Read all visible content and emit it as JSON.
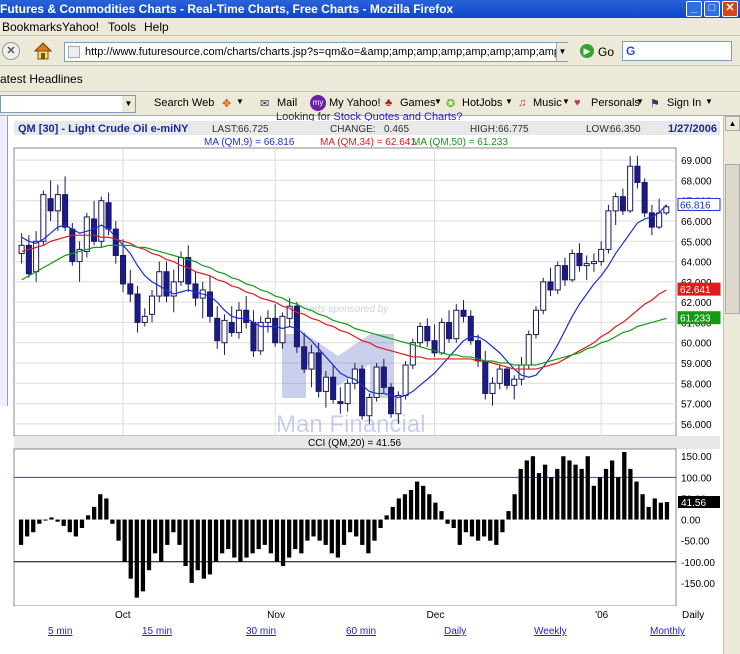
{
  "window": {
    "title": "Futures & Commodities Charts - Real-Time Charts, Free Charts - Mozilla Firefox"
  },
  "menu": [
    "Bookmarks",
    "Yahoo!",
    "Tools",
    "Help"
  ],
  "nav": {
    "url": "http://www.futuresource.com/charts/charts.jsp?s=qm&o=&amp;amp;amp;amp;amp;amp;amp;amp;amp;a=D",
    "go_label": "Go"
  },
  "bookmarks": {
    "headlines": "atest Headlines"
  },
  "ytoolbar": {
    "search_web": "Search Web",
    "mail": "Mail",
    "my_yahoo": "My Yahoo!",
    "games": "Games",
    "hotjobs": "HotJobs",
    "music": "Music",
    "personals": "Personals",
    "sign_in": "Sign In"
  },
  "page": {
    "top_link_prefix": "Looking for",
    "top_link": "Stock Quotes and Charts?"
  },
  "chart_header": {
    "symbol": "QM [30] - Light Crude Oil e-miNY",
    "last_label": "LAST:",
    "last": "66.725",
    "change_label": "CHANGE:",
    "change": "0.465",
    "high_label": "HIGH:",
    "high": "66.775",
    "low_label": "LOW:",
    "low": "66.350",
    "date": "1/27/2006",
    "ma9": "MA (QM,9) = 66.816",
    "ma34": "MA (QM,34) = 62.641",
    "ma50": "MA (QM,50) = 61.233"
  },
  "watermark": {
    "sponsor": "Charts sponsored by",
    "brand": "Man Financial"
  },
  "cci_label": "CCI (QM,20) = 41.56",
  "colors": {
    "ma9": "#1c2fd6",
    "ma34": "#e21a1a",
    "ma50": "#159a15",
    "candle_up": "#ffffff",
    "candle_down": "#1a1a8a",
    "cci_bar": "#000000",
    "cci_ref": "#3b3bcc"
  },
  "bottom_tabs": [
    "5 min",
    "15 min",
    "30 min",
    "60 min",
    "Daily",
    "Weekly",
    "Monthly"
  ],
  "chart_data": [
    {
      "type": "candlestick",
      "title": "QM [30] - Light Crude Oil e-miNY",
      "x_labels": [
        "Oct",
        "Nov",
        "Dec",
        "'06",
        "Daily"
      ],
      "ylim": [
        55.5,
        69.5
      ],
      "y_ticks": [
        56,
        57,
        58,
        59,
        60,
        61,
        62,
        63,
        64,
        65,
        66,
        67,
        68,
        69
      ],
      "price_tags": [
        {
          "value": 66.816,
          "series": "MA9"
        },
        {
          "value": 62.641,
          "series": "MA34"
        },
        {
          "value": 61.233,
          "series": "MA50"
        }
      ],
      "ohlc": [
        [
          64.4,
          65.4,
          63.9,
          64.8
        ],
        [
          64.8,
          65.3,
          63.2,
          63.4
        ],
        [
          63.5,
          65.5,
          63.0,
          65.0
        ],
        [
          65.0,
          67.5,
          64.8,
          67.3
        ],
        [
          67.1,
          68.0,
          66.0,
          66.5
        ],
        [
          66.5,
          67.8,
          65.5,
          67.3
        ],
        [
          67.3,
          68.2,
          65.5,
          65.7
        ],
        [
          65.6,
          65.9,
          63.8,
          64.0
        ],
        [
          64.0,
          65.0,
          63.0,
          64.6
        ],
        [
          64.5,
          66.4,
          64.2,
          66.2
        ],
        [
          66.1,
          67.0,
          64.8,
          65.0
        ],
        [
          65.0,
          67.2,
          64.7,
          67.0
        ],
        [
          66.9,
          67.4,
          65.3,
          65.6
        ],
        [
          65.6,
          66.0,
          63.9,
          64.3
        ],
        [
          64.3,
          65.1,
          62.5,
          62.9
        ],
        [
          62.9,
          63.6,
          62.0,
          62.4
        ],
        [
          62.4,
          62.8,
          60.5,
          61.0
        ],
        [
          61.0,
          61.7,
          60.8,
          61.3
        ],
        [
          61.4,
          62.6,
          61.0,
          62.3
        ],
        [
          62.3,
          64.0,
          62.0,
          63.5
        ],
        [
          63.5,
          64.0,
          62.0,
          62.3
        ],
        [
          62.3,
          63.6,
          61.5,
          63.0
        ],
        [
          63.0,
          64.5,
          62.8,
          64.2
        ],
        [
          64.2,
          64.8,
          62.5,
          62.9
        ],
        [
          62.9,
          63.5,
          61.8,
          62.2
        ],
        [
          62.2,
          63.0,
          61.2,
          62.6
        ],
        [
          62.5,
          63.3,
          61.0,
          61.3
        ],
        [
          61.2,
          61.8,
          59.7,
          60.1
        ],
        [
          60.0,
          61.4,
          59.4,
          61.1
        ],
        [
          61.0,
          61.8,
          60.3,
          60.5
        ],
        [
          60.5,
          62.0,
          60.2,
          61.6
        ],
        [
          61.6,
          62.3,
          60.7,
          61.0
        ],
        [
          61.0,
          61.6,
          59.3,
          59.6
        ],
        [
          59.6,
          61.3,
          59.4,
          61.0
        ],
        [
          61.0,
          61.6,
          60.5,
          61.2
        ],
        [
          61.2,
          61.9,
          59.8,
          60.0
        ],
        [
          60.0,
          61.5,
          59.7,
          61.3
        ],
        [
          61.2,
          62.2,
          60.8,
          61.8
        ],
        [
          61.8,
          62.0,
          59.5,
          59.8
        ],
        [
          59.8,
          60.5,
          58.5,
          58.7
        ],
        [
          58.7,
          59.9,
          57.8,
          59.5
        ],
        [
          59.5,
          60.0,
          57.3,
          57.6
        ],
        [
          57.6,
          58.6,
          56.8,
          58.3
        ],
        [
          58.3,
          58.9,
          57.0,
          57.2
        ],
        [
          57.1,
          57.8,
          56.5,
          57.0
        ],
        [
          57.0,
          58.2,
          56.6,
          58.0
        ],
        [
          58.0,
          59.0,
          57.7,
          58.7
        ],
        [
          58.7,
          58.9,
          56.2,
          56.4
        ],
        [
          56.4,
          57.5,
          56.0,
          57.3
        ],
        [
          57.3,
          59.0,
          57.1,
          58.8
        ],
        [
          58.8,
          59.2,
          57.5,
          57.8
        ],
        [
          57.8,
          58.0,
          56.3,
          56.5
        ],
        [
          56.5,
          57.6,
          56.0,
          57.4
        ],
        [
          57.4,
          59.1,
          57.2,
          58.9
        ],
        [
          58.9,
          60.2,
          58.7,
          60.0
        ],
        [
          60.0,
          61.0,
          59.8,
          60.8
        ],
        [
          60.8,
          61.2,
          59.8,
          60.1
        ],
        [
          60.1,
          60.9,
          59.3,
          59.5
        ],
        [
          59.5,
          61.2,
          59.4,
          61.0
        ],
        [
          61.0,
          61.6,
          60.0,
          60.2
        ],
        [
          60.2,
          61.9,
          60.0,
          61.6
        ],
        [
          61.6,
          62.1,
          61.0,
          61.3
        ],
        [
          61.3,
          61.6,
          59.9,
          60.1
        ],
        [
          60.1,
          60.4,
          58.8,
          59.1
        ],
        [
          59.1,
          59.6,
          57.2,
          57.5
        ],
        [
          57.5,
          58.3,
          56.9,
          58.0
        ],
        [
          58.0,
          58.9,
          57.7,
          58.7
        ],
        [
          58.7,
          58.8,
          57.7,
          57.9
        ],
        [
          57.9,
          58.4,
          57.2,
          58.2
        ],
        [
          58.2,
          59.3,
          57.9,
          58.9
        ],
        [
          58.9,
          60.6,
          58.7,
          60.4
        ],
        [
          60.4,
          61.8,
          60.2,
          61.6
        ],
        [
          61.6,
          63.2,
          61.4,
          63.0
        ],
        [
          63.0,
          63.7,
          62.3,
          62.6
        ],
        [
          62.6,
          64.0,
          62.4,
          63.8
        ],
        [
          63.8,
          64.2,
          62.8,
          63.1
        ],
        [
          63.1,
          64.6,
          63.0,
          64.4
        ],
        [
          64.4,
          64.9,
          63.5,
          63.8
        ],
        [
          63.8,
          64.3,
          63.1,
          63.9
        ],
        [
          63.9,
          64.4,
          63.5,
          64.0
        ],
        [
          64.0,
          65.0,
          63.8,
          64.6
        ],
        [
          64.6,
          66.8,
          64.4,
          66.5
        ],
        [
          66.5,
          67.4,
          65.8,
          67.2
        ],
        [
          67.2,
          67.6,
          66.3,
          66.5
        ],
        [
          66.5,
          69.2,
          66.4,
          68.7
        ],
        [
          68.7,
          69.2,
          67.6,
          67.9
        ],
        [
          67.9,
          68.1,
          66.2,
          66.4
        ],
        [
          66.4,
          66.8,
          65.3,
          65.7
        ],
        [
          65.7,
          67.1,
          65.6,
          66.4
        ],
        [
          66.4,
          66.8,
          66.3,
          66.7
        ]
      ],
      "series": [
        {
          "name": "MA (QM,9)",
          "values": [
            65.2,
            65.0,
            64.9,
            65.1,
            65.4,
            65.7,
            65.8,
            65.6,
            65.4,
            65.5,
            65.6,
            65.8,
            65.6,
            65.2,
            64.8,
            64.4,
            63.8,
            63.3,
            63.0,
            62.8,
            62.6,
            62.4,
            62.5,
            62.6,
            62.5,
            62.4,
            62.3,
            62.0,
            61.6,
            61.3,
            61.2,
            61.2,
            61.0,
            60.8,
            60.8,
            60.8,
            60.7,
            60.8,
            60.7,
            60.4,
            60.1,
            59.7,
            59.3,
            58.9,
            58.5,
            58.3,
            58.2,
            57.9,
            57.6,
            57.5,
            57.5,
            57.4,
            57.3,
            57.4,
            57.6,
            57.9,
            58.2,
            58.5,
            58.9,
            59.3,
            59.7,
            60.1,
            60.3,
            60.3,
            60.1,
            59.8,
            59.5,
            59.1,
            58.7,
            58.4,
            58.3,
            58.4,
            58.8,
            59.3,
            59.9,
            60.6,
            61.3,
            61.9,
            62.4,
            62.9,
            63.3,
            63.8,
            64.4,
            64.9,
            65.4,
            65.9,
            66.1,
            66.2,
            66.4,
            66.8
          ]
        },
        {
          "name": "MA (QM,34)",
          "values": [
            64.5,
            64.6,
            64.7,
            64.8,
            65.0,
            65.1,
            65.2,
            65.3,
            65.3,
            65.3,
            65.3,
            65.2,
            65.2,
            65.1,
            65.0,
            64.9,
            64.7,
            64.6,
            64.4,
            64.3,
            64.1,
            64.0,
            63.8,
            63.7,
            63.5,
            63.4,
            63.3,
            63.1,
            63.0,
            62.8,
            62.7,
            62.5,
            62.4,
            62.2,
            62.1,
            62.0,
            61.8,
            61.7,
            61.5,
            61.4,
            61.2,
            61.1,
            60.9,
            60.8,
            60.6,
            60.5,
            60.3,
            60.1,
            60.0,
            59.8,
            59.7,
            59.6,
            59.5,
            59.4,
            59.3,
            59.3,
            59.2,
            59.2,
            59.2,
            59.2,
            59.2,
            59.2,
            59.2,
            59.1,
            59.1,
            59.0,
            58.9,
            58.8,
            58.7,
            58.7,
            58.7,
            58.7,
            58.8,
            58.9,
            59.0,
            59.2,
            59.4,
            59.6,
            59.8,
            60.0,
            60.3,
            60.5,
            60.8,
            61.0,
            61.3,
            61.6,
            61.9,
            62.1,
            62.4,
            62.6
          ]
        },
        {
          "name": "MA (QM,50)",
          "values": [
            63.1,
            63.3,
            63.5,
            63.7,
            63.9,
            64.1,
            64.3,
            64.4,
            64.5,
            64.6,
            64.7,
            64.7,
            64.8,
            64.8,
            64.8,
            64.8,
            64.7,
            64.7,
            64.6,
            64.5,
            64.4,
            64.3,
            64.2,
            64.1,
            64.0,
            63.8,
            63.7,
            63.5,
            63.4,
            63.2,
            63.1,
            62.9,
            62.8,
            62.6,
            62.5,
            62.3,
            62.2,
            62.0,
            61.9,
            61.7,
            61.6,
            61.4,
            61.3,
            61.1,
            61.0,
            60.9,
            60.7,
            60.6,
            60.5,
            60.4,
            60.3,
            60.2,
            60.1,
            60.0,
            59.9,
            59.8,
            59.7,
            59.6,
            59.5,
            59.4,
            59.4,
            59.3,
            59.3,
            59.2,
            59.1,
            59.1,
            59.0,
            59.0,
            58.9,
            58.9,
            58.9,
            58.9,
            59.0,
            59.1,
            59.2,
            59.3,
            59.4,
            59.5,
            59.7,
            59.8,
            60.0,
            60.1,
            60.3,
            60.5,
            60.6,
            60.8,
            60.9,
            61.0,
            61.1,
            61.2
          ]
        }
      ]
    },
    {
      "type": "bar",
      "title": "CCI (QM,20) = 41.56",
      "ylim": [
        -200,
        160
      ],
      "y_ticks": [
        150,
        100,
        50,
        0,
        -50,
        -100,
        -150
      ],
      "reference_lines": [
        100,
        -100
      ],
      "last_value": 41.56,
      "values": [
        -60,
        -40,
        -30,
        -10,
        0,
        5,
        -5,
        -15,
        -30,
        -40,
        -20,
        10,
        30,
        60,
        50,
        -10,
        -50,
        -100,
        -140,
        -185,
        -170,
        -120,
        -80,
        -100,
        -60,
        -30,
        -60,
        -110,
        -150,
        -120,
        -140,
        -130,
        -100,
        -80,
        -70,
        -90,
        -100,
        -90,
        -80,
        -70,
        -60,
        -80,
        -100,
        -110,
        -90,
        -70,
        -80,
        -50,
        -40,
        -50,
        -60,
        -80,
        -90,
        -60,
        -30,
        -40,
        -60,
        -80,
        -50,
        -20,
        10,
        30,
        50,
        60,
        70,
        90,
        80,
        60,
        40,
        20,
        -10,
        -20,
        -60,
        -30,
        -40,
        -50,
        -40,
        -50,
        -60,
        -30,
        20,
        60,
        120,
        140,
        150,
        110,
        130,
        100,
        120,
        150,
        140,
        130,
        120,
        150,
        80,
        100,
        120,
        140,
        100,
        160,
        120,
        90,
        60,
        30,
        50,
        40,
        41.56
      ]
    }
  ]
}
